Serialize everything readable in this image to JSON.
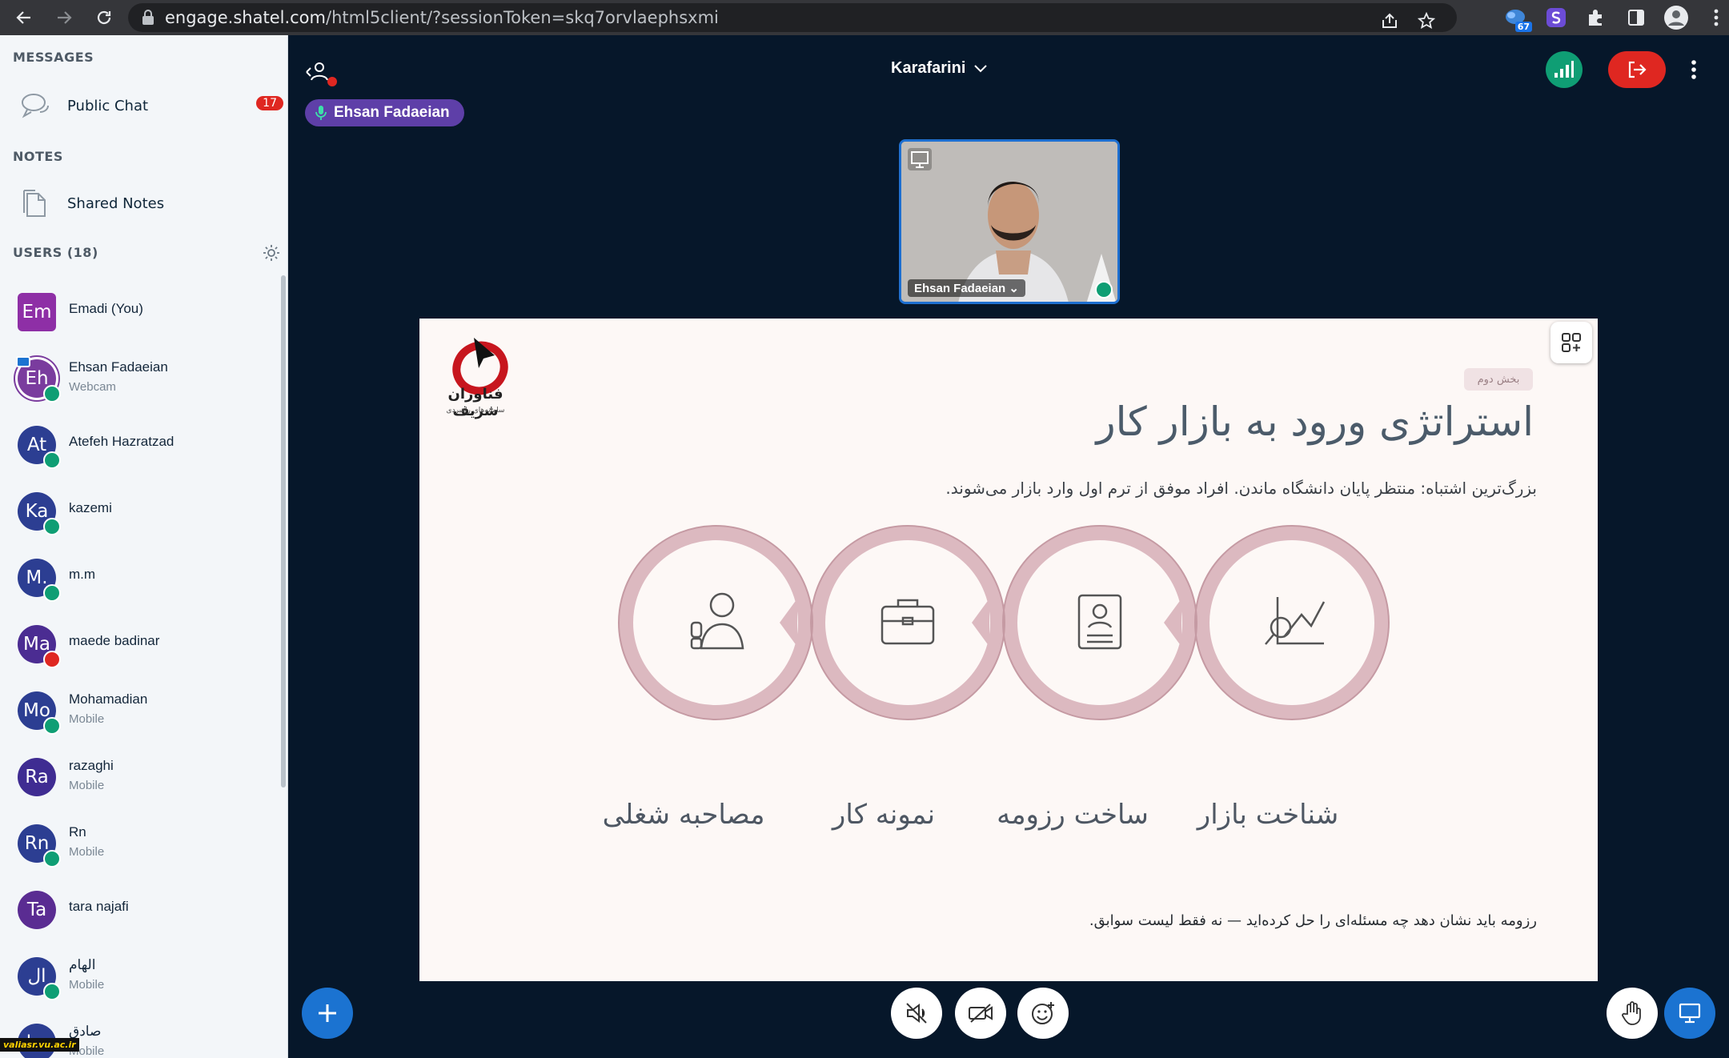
{
  "browser": {
    "url_host": "engage.shatel.com",
    "url_path": "/html5client/?sessionToken=skq7orvlaephsxmi",
    "ext_badge": "67"
  },
  "sidebar": {
    "messages_title": "MESSAGES",
    "public_chat_label": "Public Chat",
    "public_chat_unread": "17",
    "notes_title": "NOTES",
    "shared_notes_label": "Shared Notes",
    "users_title": "USERS (18)",
    "users": [
      {
        "initials": "Em",
        "name": "Emadi (You)",
        "sub": "",
        "color": "#8e2fa6",
        "status": "none"
      },
      {
        "initials": "Eh",
        "name": "Ehsan Fadaeian",
        "sub": "Webcam",
        "color": "#7a3c9e",
        "status": "mic"
      },
      {
        "initials": "At",
        "name": "Atefeh Hazratzad",
        "sub": "",
        "color": "#2c3e92",
        "status": "listen"
      },
      {
        "initials": "Ka",
        "name": "kazemi",
        "sub": "",
        "color": "#2c3e92",
        "status": "listen"
      },
      {
        "initials": "M.",
        "name": "m.m",
        "sub": "",
        "color": "#2c3e92",
        "status": "listen"
      },
      {
        "initials": "Ma",
        "name": "maede badinar",
        "sub": "",
        "color": "#4b2c92",
        "status": "muted"
      },
      {
        "initials": "Mo",
        "name": "Mohamadian",
        "sub": "Mobile",
        "color": "#2c3e92",
        "status": "listen"
      },
      {
        "initials": "Ra",
        "name": "razaghi",
        "sub": "Mobile",
        "color": "#3f2c92",
        "status": "none"
      },
      {
        "initials": "Rn",
        "name": "Rn",
        "sub": "Mobile",
        "color": "#2c3e92",
        "status": "listen"
      },
      {
        "initials": "Ta",
        "name": "tara najafi",
        "sub": "",
        "color": "#5a2c92",
        "status": "none"
      },
      {
        "initials": "ال",
        "name": "الهام",
        "sub": "Mobile",
        "color": "#2c3e92",
        "status": "listen"
      },
      {
        "initials": "صا",
        "name": "صادق",
        "sub": "Mobile",
        "color": "#2c3e92",
        "status": "none"
      }
    ],
    "watermark": "valiasr.vu.ac.ir"
  },
  "main": {
    "meeting_title": "Karafarini",
    "talking_user": "Ehsan Fadaeian",
    "webcam_name": "Ehsan Fadaeian"
  },
  "slide": {
    "logo_text": "فناوران شریف",
    "logo_sub": "سامانه‌های راهبردی",
    "tag": "بخش دوم",
    "title": "استراتژی ورود به بازار کار",
    "subtitle": "بزرگ‌ترین اشتباه: منتظر پایان دانشگاه ماندن. افراد موفق از ترم اول وارد بازار می‌شوند.",
    "steps": [
      "شناخت بازار",
      "ساخت رزومه",
      "نمونه کار",
      "مصاحبه شغلی"
    ],
    "footer": "رزومه باید نشان دهد چه مسئله‌ای را حل کرده‌اید — نه فقط لیست سوابق."
  },
  "colors": {
    "accent_blue": "#1b73d1",
    "danger": "#df2721",
    "success": "#0f9e74",
    "slide_ring": "#dcb9c0"
  },
  "icons": {
    "back": "arrow-left-icon",
    "forward": "arrow-right-icon",
    "reload": "reload-icon"
  }
}
